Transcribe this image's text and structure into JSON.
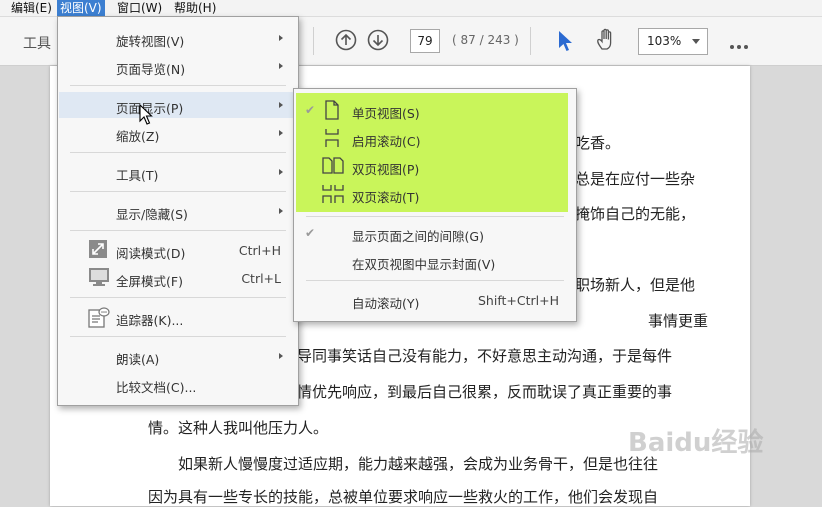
{
  "menubar": {
    "items": [
      {
        "label": "编辑(E)",
        "active": false
      },
      {
        "label": "视图(V)",
        "active": true
      },
      {
        "label": "窗口(W)",
        "active": false
      },
      {
        "label": "帮助(H)",
        "active": false
      }
    ]
  },
  "toolbar": {
    "tools_label": "工具",
    "page_input": "79",
    "page_count": "( 87 / 243 )",
    "zoom_value": "103%"
  },
  "document": {
    "lines": [
      "吃香。",
      "总是在应付一些杂",
      "掩饰自己的无能，",
      "职场新人，但是他",
      "事情更重",
      "导同事笑话自己没有能力，不好意思主动沟通，于是每件",
      "情优先响应，到最后自己很累，反而耽误了真正重要的事",
      "情。这种人我叫他压力人。",
      "如果新人慢慢度过适应期，能力越来越强，会成为业务骨干，但是也往往",
      "因为具有一些专长的技能，总被单位要求响应一些救火的工作，他们会发现自"
    ]
  },
  "view_menu": {
    "items": [
      {
        "label": "旋转视图(V)"
      },
      {
        "label": "页面导览(N)"
      },
      {
        "label": "页面显示(P)"
      },
      {
        "label": "缩放(Z)"
      },
      {
        "label": "工具(T)"
      },
      {
        "label": "显示/隐藏(S)"
      },
      {
        "label": "阅读模式(D)",
        "shortcut": "Ctrl+H"
      },
      {
        "label": "全屏模式(F)",
        "shortcut": "Ctrl+L"
      },
      {
        "label": "追踪器(K)..."
      },
      {
        "label": "朗读(A)"
      },
      {
        "label": "比较文档(C)..."
      }
    ]
  },
  "page_display_submenu": {
    "items": [
      {
        "label": "单页视图(S)",
        "checked": true
      },
      {
        "label": "启用滚动(C)",
        "checked": false
      },
      {
        "label": "双页视图(P)",
        "checked": false
      },
      {
        "label": "双页滚动(T)",
        "checked": false
      },
      {
        "label": "显示页面之间的间隙(G)",
        "checked": true
      },
      {
        "label": "在双页视图中显示封面(V)",
        "checked": false
      },
      {
        "label": "自动滚动(Y)",
        "shortcut": "Shift+Ctrl+H"
      }
    ]
  },
  "watermark": {
    "text": "Baidu经验"
  },
  "colors": {
    "highlight": "#c9f55a",
    "menu_active": "#3c7fd1",
    "icon_blue": "#2b6ad1"
  }
}
